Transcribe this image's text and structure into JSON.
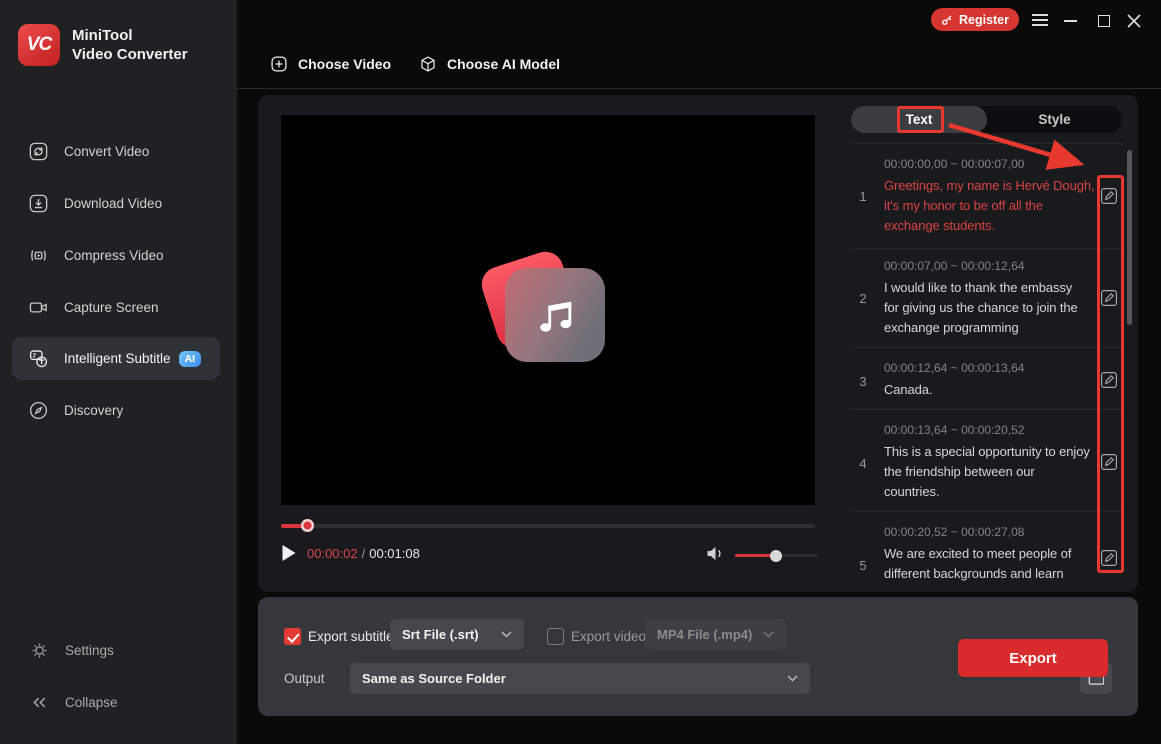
{
  "colors": {
    "accent_red": "#d6362f",
    "annotation_red": "#e8392e",
    "highlight_subtitle_red": "#dc4343",
    "sidebar_bg": "#1f2123",
    "panel_bg": "#191a1d",
    "export_bar_bg": "#36373b",
    "ai_badge_blue": "#3f8ef0"
  },
  "icons": [
    "vc-logo",
    "key-icon",
    "hamburger-menu-icon",
    "minimize-icon",
    "maximize-icon",
    "close-icon",
    "convert-icon",
    "download-icon",
    "compress-icon",
    "capture-icon",
    "subtitle-icon",
    "discovery-icon",
    "gear-icon",
    "collapse-icon",
    "plus-square-icon",
    "cube-icon",
    "music-note-icon",
    "play-icon",
    "speaker-icon",
    "edit-icon",
    "chevron-down-icon",
    "folder-icon",
    "check-icon"
  ],
  "sidebar": {
    "logo_text": "VC",
    "brand_line1": "MiniTool",
    "brand_line2": "Video Converter",
    "items": [
      {
        "label": "Convert Video"
      },
      {
        "label": "Download Video"
      },
      {
        "label": "Compress Video"
      },
      {
        "label": "Capture Screen"
      },
      {
        "label": "Intelligent Subtitle",
        "badge": "AI",
        "active": true
      },
      {
        "label": "Discovery"
      }
    ],
    "footer_items": [
      {
        "label": "Settings"
      },
      {
        "label": "Collapse"
      }
    ]
  },
  "titlebar": {
    "register_label": "Register"
  },
  "toolbar": {
    "tabs": [
      {
        "label": "Choose Video"
      },
      {
        "label": "Choose AI Model"
      }
    ]
  },
  "player": {
    "current_time": "00:00:02",
    "time_separator": "/",
    "total_time": "00:01:08",
    "progress_percent": 5,
    "volume_percent": 50
  },
  "subtitle_panel": {
    "tabs": [
      {
        "label": "Text",
        "active": true
      },
      {
        "label": "Style",
        "active": false
      }
    ],
    "entries": [
      {
        "index": "1",
        "time": "00:00:00,00 ~ 00:00:07,00",
        "text": "Greetings, my name is Hervé Dough,\nit's my honor to be off all the\nexchange students.",
        "highlighted": true
      },
      {
        "index": "2",
        "time": "00:00:07,00 ~ 00:00:12,64",
        "text": "I would like to thank the embassy\nfor giving us the chance to join the\nexchange programming",
        "highlighted": false
      },
      {
        "index": "3",
        "time": "00:00:12,64 ~ 00:00:13,64",
        "text": "Canada.",
        "highlighted": false
      },
      {
        "index": "4",
        "time": "00:00:13,64 ~ 00:00:20,52",
        "text": "This is a special opportunity to enjoy\nthe friendship between our\ncountries.",
        "highlighted": false
      },
      {
        "index": "5",
        "time": "00:00:20,52 ~ 00:00:27,08",
        "text": "We are excited to meet people of\ndifferent backgrounds and learn",
        "highlighted": false
      }
    ]
  },
  "export_bar": {
    "export_subtitle_label": "Export subtitle",
    "export_subtitle_checked": true,
    "subtitle_format_value": "Srt File (.srt)",
    "export_video_label": "Export video",
    "export_video_checked": false,
    "video_format_value": "MP4 File (.mp4)",
    "output_label": "Output",
    "output_value": "Same as Source Folder",
    "export_button_label": "Export"
  }
}
